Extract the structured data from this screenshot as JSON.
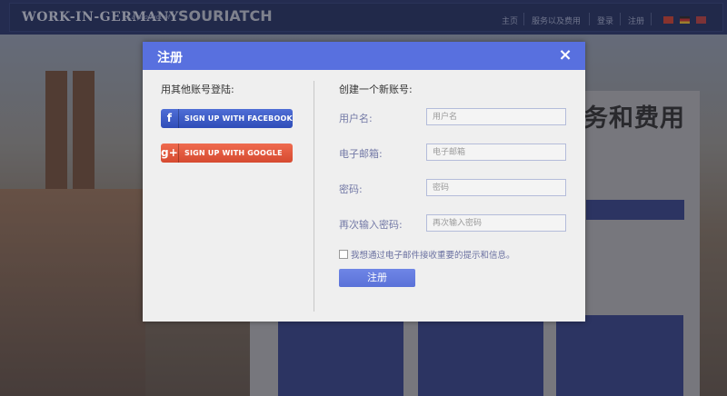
{
  "background": {
    "site_logo": "WORK-IN-GERMANY",
    "logo_tagline": "...a product of",
    "brand": "SOURIATCH",
    "nav": [
      "主页",
      "服务以及费用",
      "登录",
      "注册"
    ],
    "hero_title": "务和费用"
  },
  "modal": {
    "title": "注册",
    "close": "×",
    "social": {
      "heading": "用其他账号登陆:",
      "facebook_icon": "f",
      "facebook_label": "SIGN UP WITH FACEBOOK",
      "google_icon": "g+",
      "google_label": "SIGN UP WITH GOOGLE"
    },
    "form": {
      "heading": "创建一个新账号:",
      "username_label": "用户名:",
      "username_placeholder": "用户名",
      "username_value": "",
      "email_label": "电子邮箱:",
      "email_placeholder": "电子邮箱",
      "email_value": "",
      "password_label": "密码:",
      "password_placeholder": "密码",
      "password_value": "",
      "confirm_label": "再次输入密码:",
      "confirm_placeholder": "再次输入密码",
      "confirm_value": "",
      "newsletter_label": "我想通过电子邮件接收重要的提示和信息。",
      "newsletter_checked": false,
      "submit_label": "注册"
    }
  },
  "colors": {
    "header_blue": "#5870df",
    "facebook_blue": "#3b5bc6",
    "google_red": "#e2583c",
    "label_color": "#7379a6"
  }
}
